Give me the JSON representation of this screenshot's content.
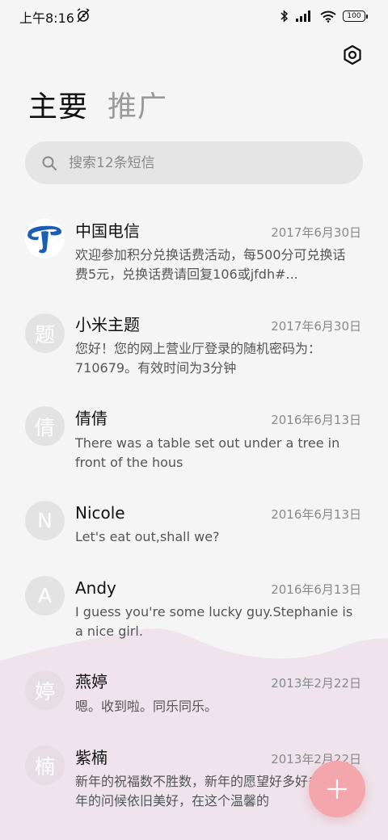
{
  "status_bar": {
    "time": "上午8:16",
    "battery": "100"
  },
  "tabs": [
    {
      "label": "主要",
      "active": true
    },
    {
      "label": "推广",
      "active": false
    }
  ],
  "search": {
    "placeholder": "搜索12条短信"
  },
  "messages": [
    {
      "sender": "中国电信",
      "date": "2017年6月30日",
      "preview": "欢迎参加积分兑换话费活动，每500分可兑换话费5元，兑换话费请回复106或jfdh#...",
      "avatar": "china-telecom-logo"
    },
    {
      "sender": "小米主题",
      "date": "2017年6月30日",
      "preview": "您好！您的网上营业厅登录的随机密码为：710679。有效时间为3分钟",
      "avatar_text": "题"
    },
    {
      "sender": "倩倩",
      "date": "2016年6月13日",
      "preview": "There was a table set out under a tree in front of the hous",
      "avatar_text": "倩"
    },
    {
      "sender": "Nicole",
      "date": "2016年6月13日",
      "preview": "Let's eat out,shall we?",
      "avatar_text": "N"
    },
    {
      "sender": "Andy",
      "date": "2016年6月13日",
      "preview": "I guess you're some lucky guy.Stephanie is a nice girl.",
      "avatar_text": "A"
    },
    {
      "sender": "燕婷",
      "date": "2013年2月22日",
      "preview": "嗯。收到啦。同乐同乐。",
      "avatar_text": "婷"
    },
    {
      "sender": "紫楠",
      "date": "2013年2月22日",
      "preview": "新年的祝福数不胜数，新年的愿望好多好多，新年的问候依旧美好，在这个温馨的",
      "avatar_text": "楠"
    }
  ],
  "colors": {
    "background": "#f5f5f5",
    "wave_pink": "#efe4ed",
    "fab": "#f3a7ac",
    "telecom_blue": "#1b5fb4"
  },
  "icons": {
    "settings": "gear-icon",
    "search": "search-icon",
    "compose": "plus-icon"
  }
}
